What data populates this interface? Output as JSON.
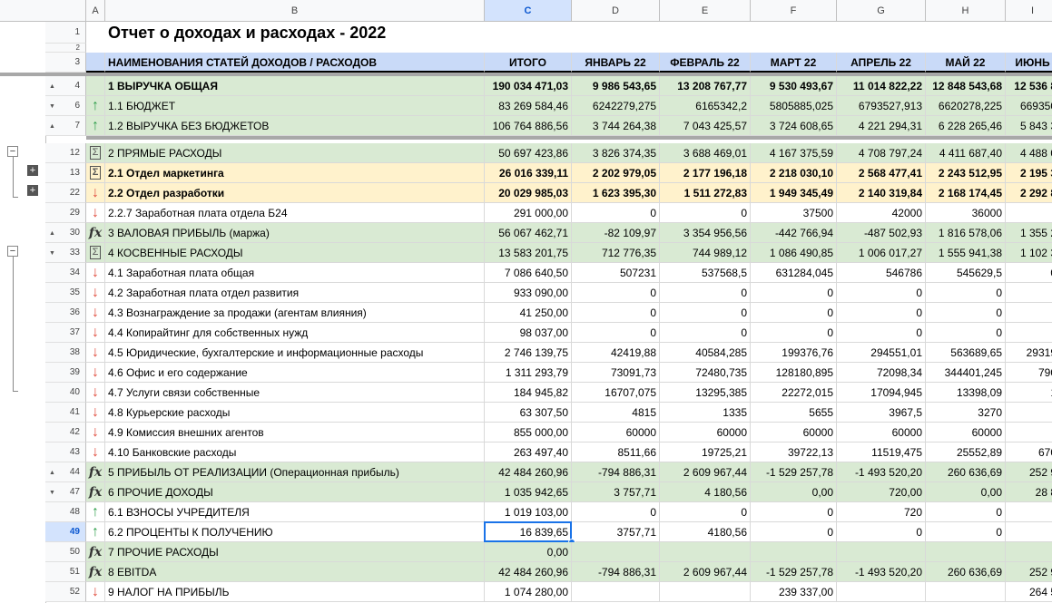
{
  "columns": [
    "A",
    "B",
    "C",
    "D",
    "E",
    "F",
    "G",
    "H",
    "I"
  ],
  "title": "Отчет о доходах и расходах - 2022",
  "header": [
    "НАИМЕНОВАНИЯ СТАТЕЙ ДОХОДОВ / РАСХОДОВ",
    "ИТОГО",
    "ЯНВАРЬ 22",
    "ФЕВРАЛЬ 22",
    "МАРТ 22",
    "АПРЕЛЬ 22",
    "МАЙ 22",
    "ИЮНЬ"
  ],
  "rows": [
    {
      "n": "4",
      "style": "green bold",
      "icon": "",
      "tri": "▲",
      "c": [
        "1  ВЫРУЧКА ОБЩАЯ",
        "190 034 471,03",
        "9 986 543,65",
        "13 208 767,77",
        "9 530 493,67",
        "11 014 822,22",
        "12 848 543,68",
        "12 536 8"
      ]
    },
    {
      "n": "6",
      "style": "green",
      "icon": "up",
      "tri": "▼",
      "c": [
        "1.1  БЮДЖЕТ",
        "83 269 584,46",
        "6242279,275",
        "6165342,2",
        "5805885,025",
        "6793527,913",
        "6620278,225",
        "669350"
      ]
    },
    {
      "n": "7",
      "style": "green",
      "icon": "up",
      "tri": "▲",
      "c": [
        "1.2  ВЫРУЧКА БЕЗ БЮДЖЕТОВ",
        "106 764 886,56",
        "3 744 264,38",
        "7 043 425,57",
        "3 724 608,65",
        "4 221 294,31",
        "6 228 265,46",
        "5 843 3"
      ]
    },
    {
      "n": "12",
      "style": "green",
      "icon": "fold",
      "tri": "",
      "c": [
        "2   ПРЯМЫЕ РАСХОДЫ",
        "50 697 423,86",
        "3 826 374,35",
        "3 688 469,01",
        "4 167 375,59",
        "4 708 797,24",
        "4 411 687,40",
        "4 488 0"
      ]
    },
    {
      "n": "13",
      "style": "yellow bold",
      "icon": "fold",
      "tri": "",
      "c": [
        "2.1    Отдел маркетинга",
        "26 016 339,11",
        "2 202 979,05",
        "2 177 196,18",
        "2 218 030,10",
        "2 568 477,41",
        "2 243 512,95",
        "2 195 3"
      ]
    },
    {
      "n": "22",
      "style": "yellow bold",
      "icon": "down",
      "tri": "",
      "c": [
        "2.2    Отдел разработки",
        "20 029 985,03",
        "1 623 395,30",
        "1 511 272,83",
        "1 949 345,49",
        "2 140 319,84",
        "2 168 174,45",
        "2 292 8"
      ]
    },
    {
      "n": "29",
      "style": "",
      "icon": "down",
      "tri": "",
      "c": [
        "2.2.7    Заработная плата отдела Б24",
        "291 000,00",
        "0",
        "0",
        "37500",
        "42000",
        "36000",
        ""
      ]
    },
    {
      "n": "30",
      "style": "green",
      "icon": "fx",
      "tri": "▲",
      "c": [
        "3   ВАЛОВАЯ ПРИБЫЛЬ (маржа)",
        "56 067 462,71",
        "-82 109,97",
        "3 354 956,56",
        "-442 766,94",
        "-487 502,93",
        "1 816 578,06",
        "1 355 2"
      ]
    },
    {
      "n": "33",
      "style": "green",
      "icon": "fold",
      "tri": "▼",
      "c": [
        "4   КОСВЕННЫЕ РАСХОДЫ",
        "13 583 201,75",
        "712 776,35",
        "744 989,12",
        "1 086 490,85",
        "1 006 017,27",
        "1 555 941,38",
        "1 102 3"
      ]
    },
    {
      "n": "34",
      "style": "",
      "icon": "down",
      "tri": "",
      "c": [
        "4.1 Заработная плата общая",
        "7 086 640,50",
        "507231",
        "537568,5",
        "631284,045",
        "546786",
        "545629,5",
        "0"
      ]
    },
    {
      "n": "35",
      "style": "",
      "icon": "down",
      "tri": "",
      "c": [
        "4.2 Заработная плата отдел развития",
        "933 090,00",
        "0",
        "0",
        "0",
        "0",
        "0",
        ""
      ]
    },
    {
      "n": "36",
      "style": "",
      "icon": "down",
      "tri": "",
      "c": [
        "4.3 Вознаграждение за продажи (агентам влияния)",
        "41 250,00",
        "0",
        "0",
        "0",
        "0",
        "0",
        ""
      ]
    },
    {
      "n": "37",
      "style": "",
      "icon": "down",
      "tri": "",
      "c": [
        "4.4 Копирайтинг для собственных нужд",
        "98 037,00",
        "0",
        "0",
        "0",
        "0",
        "0",
        ""
      ]
    },
    {
      "n": "38",
      "style": "",
      "icon": "down",
      "tri": "",
      "c": [
        "4.5 Юридические, бухгалтерские и информационные расходы",
        "2 746 139,75",
        "42419,88",
        "40584,285",
        "199376,76",
        "294551,01",
        "563689,65",
        "29319"
      ]
    },
    {
      "n": "39",
      "style": "",
      "icon": "down",
      "tri": "",
      "c": [
        "4.6 Офис и его содержание",
        "1 311 293,79",
        "73091,73",
        "72480,735",
        "128180,895",
        "72098,34",
        "344401,245",
        "790"
      ]
    },
    {
      "n": "40",
      "style": "",
      "icon": "down",
      "tri": "",
      "c": [
        "4.7 Услуги связи собственные",
        "184 945,82",
        "16707,075",
        "13295,385",
        "22272,015",
        "17094,945",
        "13398,09",
        "1"
      ]
    },
    {
      "n": "41",
      "style": "",
      "icon": "down",
      "tri": "",
      "c": [
        "4.8 Курьерские расходы",
        "63 307,50",
        "4815",
        "1335",
        "5655",
        "3967,5",
        "3270",
        ""
      ]
    },
    {
      "n": "42",
      "style": "",
      "icon": "down",
      "tri": "",
      "c": [
        "4.9 Комиссия внешних агентов",
        "855 000,00",
        "60000",
        "60000",
        "60000",
        "60000",
        "60000",
        ""
      ]
    },
    {
      "n": "43",
      "style": "",
      "icon": "down",
      "tri": "",
      "c": [
        "4.10 Банковские расходы",
        "263 497,40",
        "8511,66",
        "19725,21",
        "39722,13",
        "11519,475",
        "25552,89",
        "670"
      ]
    },
    {
      "n": "44",
      "style": "green",
      "icon": "fx",
      "tri": "▲",
      "c": [
        "5   ПРИБЫЛЬ ОТ РЕАЛИЗАЦИИ (Операционная прибыль)",
        "42 484 260,96",
        "-794 886,31",
        "2 609 967,44",
        "-1 529 257,78",
        "-1 493 520,20",
        "260 636,69",
        "252 9"
      ]
    },
    {
      "n": "47",
      "style": "green",
      "icon": "fx",
      "tri": "▼",
      "c": [
        "6   ПРОЧИЕ ДОХОДЫ",
        "1 035 942,65",
        "3 757,71",
        "4 180,56",
        "0,00",
        "720,00",
        "0,00",
        "28 8"
      ]
    },
    {
      "n": "48",
      "style": "",
      "icon": "up",
      "tri": "",
      "c": [
        "6.1  ВЗНОСЫ УЧРЕДИТЕЛЯ",
        "1 019 103,00",
        "0",
        "0",
        "0",
        "720",
        "0",
        ""
      ]
    },
    {
      "n": "49",
      "style": "",
      "icon": "up",
      "tri": "",
      "c": [
        "6.2  ПРОЦЕНТЫ К ПОЛУЧЕНИЮ",
        "16 839,65",
        "3757,71",
        "4180,56",
        "0",
        "0",
        "0",
        ""
      ]
    },
    {
      "n": "50",
      "style": "green",
      "icon": "fx",
      "tri": "",
      "c": [
        "7   ПРОЧИЕ РАСХОДЫ",
        "0,00",
        "",
        "",
        "",
        "",
        "",
        ""
      ]
    },
    {
      "n": "51",
      "style": "green",
      "icon": "fx",
      "tri": "",
      "c": [
        "8   EBITDA",
        "42 484 260,96",
        "-794 886,31",
        "2 609 967,44",
        "-1 529 257,78",
        "-1 493 520,20",
        "260 636,69",
        "252 9"
      ]
    },
    {
      "n": "52",
      "style": "",
      "icon": "down",
      "tri": "",
      "c": [
        "9   НАЛОГ НА ПРИБЫЛЬ",
        "1 074 280,00",
        "",
        "",
        "239 337,00",
        "",
        "",
        "264 5"
      ]
    }
  ],
  "selected_cell": "C49"
}
